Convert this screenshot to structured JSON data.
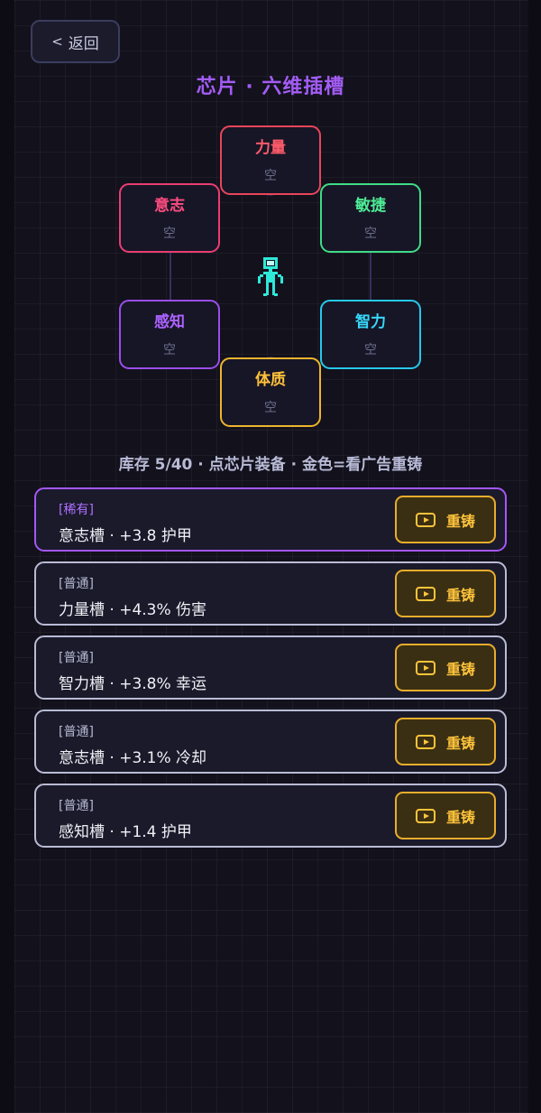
{
  "back": {
    "label": "返回",
    "icon": "chevron-left-icon"
  },
  "title": "芯片 · 六维插槽",
  "slots": {
    "power": {
      "name": "力量",
      "value": "空"
    },
    "will": {
      "name": "意志",
      "value": "空"
    },
    "agile": {
      "name": "敏捷",
      "value": "空"
    },
    "sense": {
      "name": "感知",
      "value": "空"
    },
    "intel": {
      "name": "智力",
      "value": "空"
    },
    "body": {
      "name": "体质",
      "value": "空"
    }
  },
  "status": "库存 5/40 · 点芯片装备 · 金色=看广告重铸",
  "chips": [
    {
      "rarity": "[稀有]",
      "desc": "意志槽 · +3.8 护甲",
      "action": "重铸"
    },
    {
      "rarity": "[普通]",
      "desc": "力量槽 · +4.3% 伤害",
      "action": "重铸"
    },
    {
      "rarity": "[普通]",
      "desc": "智力槽 · +3.8% 幸运",
      "action": "重铸"
    },
    {
      "rarity": "[普通]",
      "desc": "意志槽 · +3.1% 冷却",
      "action": "重铸"
    },
    {
      "rarity": "[普通]",
      "desc": "感知槽 · +1.4 护甲",
      "action": "重铸"
    }
  ],
  "colors": {
    "title": "#a35cf5",
    "rare": "#a457f5",
    "common": "#b9bbd4",
    "gold": "#e9ad2c",
    "power": "#e8465a",
    "will": "#ea3d72",
    "agile": "#3fdc86",
    "sense": "#9a4eea",
    "intel": "#26c8ea",
    "body": "#eeb42c",
    "robot": "#2ee8d8"
  }
}
